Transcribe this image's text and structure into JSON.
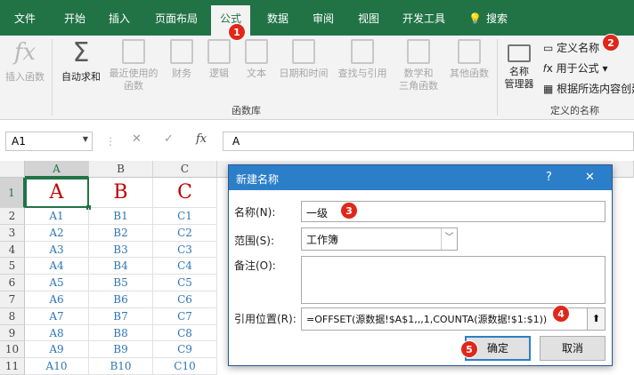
{
  "tabs": [
    "文件",
    "开始",
    "插入",
    "页面布局",
    "公式",
    "数据",
    "审阅",
    "视图",
    "开发工具",
    "搜索"
  ],
  "ribbon": {
    "insert_function": "插入函数",
    "autosum": "自动求和",
    "recent_1": "最近使用的",
    "recent_2": "函数",
    "finance": "财务",
    "logic": "逻辑",
    "text": "文本",
    "datetime": "日期和时间",
    "lookup": "查找与引用",
    "math_1": "数学和",
    "math_2": "三角函数",
    "other": "其他函数",
    "group_library": "函数库",
    "name_mgr_1": "名称",
    "name_mgr_2": "管理器",
    "define_name": "定义名称",
    "use_in_formula": "用于公式",
    "create_from_sel": "根据所选内容创建",
    "group_names": "定义的名称"
  },
  "formula_bar": {
    "name_box": "A1",
    "formula": "A"
  },
  "grid": {
    "columns": [
      "A",
      "B",
      "C"
    ],
    "rows": [
      "1",
      "2",
      "3",
      "4",
      "5",
      "6",
      "7",
      "8",
      "9",
      "10",
      "11"
    ],
    "header_row": [
      "A",
      "B",
      "C"
    ],
    "data": [
      [
        "A1",
        "B1",
        "C1"
      ],
      [
        "A2",
        "B2",
        "C2"
      ],
      [
        "A3",
        "B3",
        "C3"
      ],
      [
        "A4",
        "B4",
        "C4"
      ],
      [
        "A5",
        "B5",
        "C5"
      ],
      [
        "A6",
        "B6",
        "C6"
      ],
      [
        "A7",
        "B7",
        "C7"
      ],
      [
        "A8",
        "B8",
        "C8"
      ],
      [
        "A9",
        "B9",
        "C9"
      ],
      [
        "A10",
        "B10",
        "C10"
      ]
    ]
  },
  "dialog": {
    "title": "新建名称",
    "help": "?",
    "close": "✕",
    "name_label": "名称(N):",
    "name_value": "一级",
    "scope_label": "范围(S):",
    "scope_value": "工作簿",
    "comment_label": "备注(O):",
    "comment_value": "",
    "refers_label": "引用位置(R):",
    "refers_value": "=OFFSET(源数据!$A$1,,,1,COUNTA(源数据!$1:$1))",
    "ok": "确定",
    "cancel": "取消"
  },
  "badges": [
    "1",
    "2",
    "3",
    "4",
    "5"
  ],
  "colors": {
    "excel_green": "#217346",
    "dialog_blue": "#2b7fc9",
    "badge_red": "#e0271a",
    "cell_blue": "#2e75b6",
    "header_red": "#c00000"
  }
}
